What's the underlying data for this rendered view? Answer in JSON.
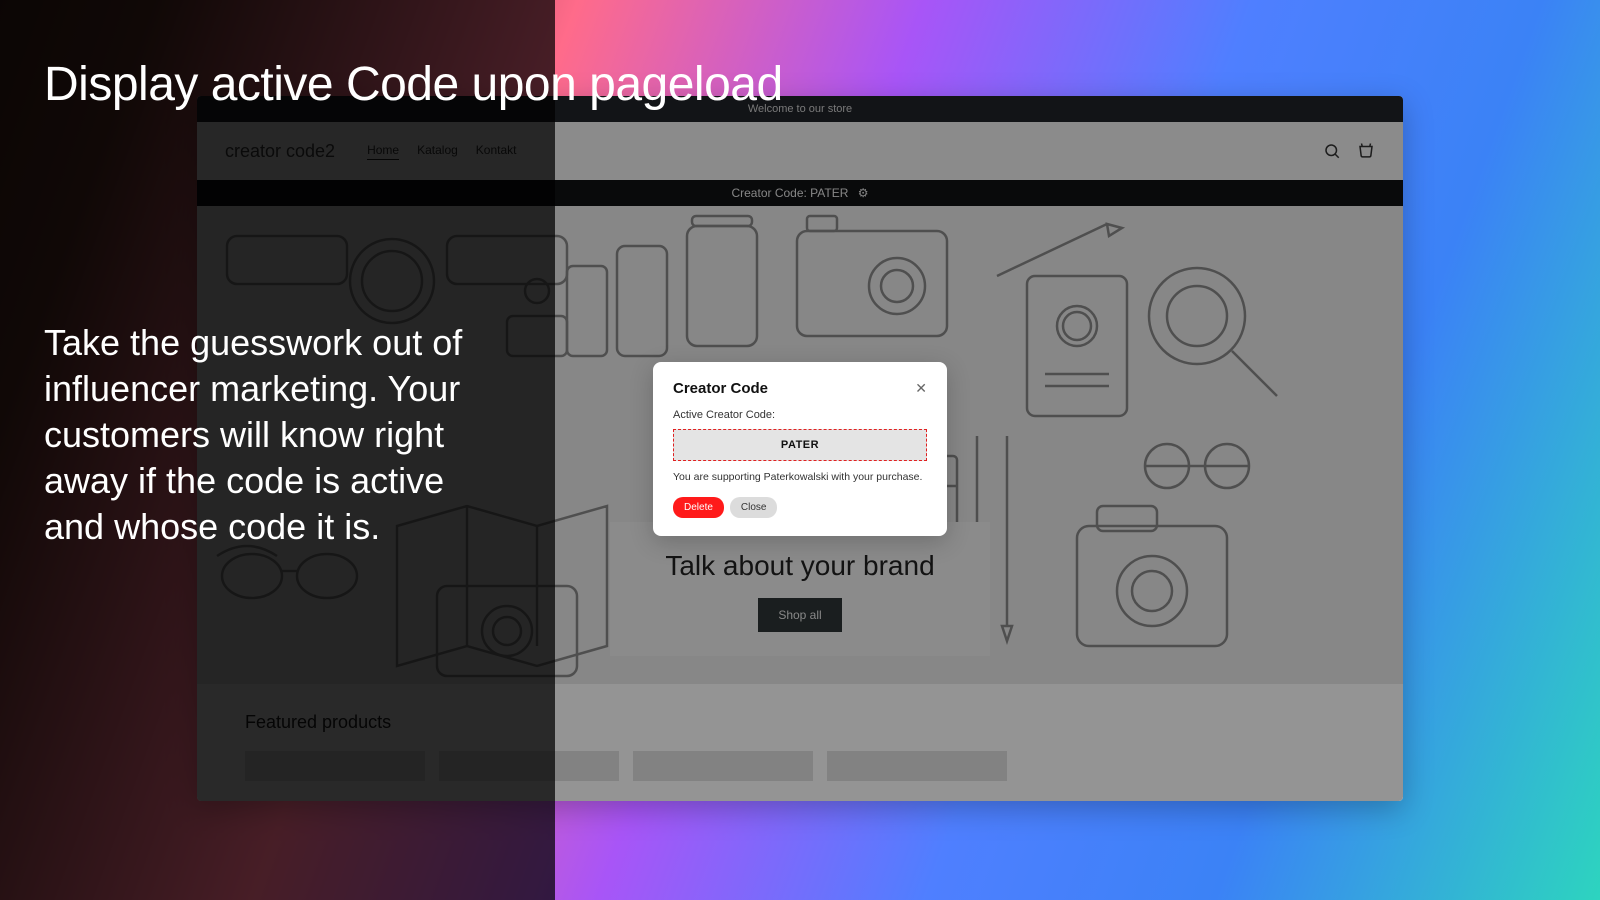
{
  "promo": {
    "title": "Display active Code upon pageload",
    "body": "Take the guesswork out of influencer marketing. Your customers will know right away if the code is active and whose code it is."
  },
  "announce": "Welcome to our store",
  "store": {
    "logo": "creator code2",
    "nav": [
      "Home",
      "Katalog",
      "Kontakt"
    ],
    "active_nav_index": 0
  },
  "code_banner": "Creator Code: PATER",
  "hero": {
    "heading": "Talk about your brand",
    "button": "Shop all"
  },
  "featured": {
    "title": "Featured products"
  },
  "modal": {
    "title": "Creator Code",
    "subtitle": "Active Creator Code:",
    "code": "PATER",
    "support": "You are supporting Paterkowalski with your purchase.",
    "delete": "Delete",
    "close": "Close"
  }
}
